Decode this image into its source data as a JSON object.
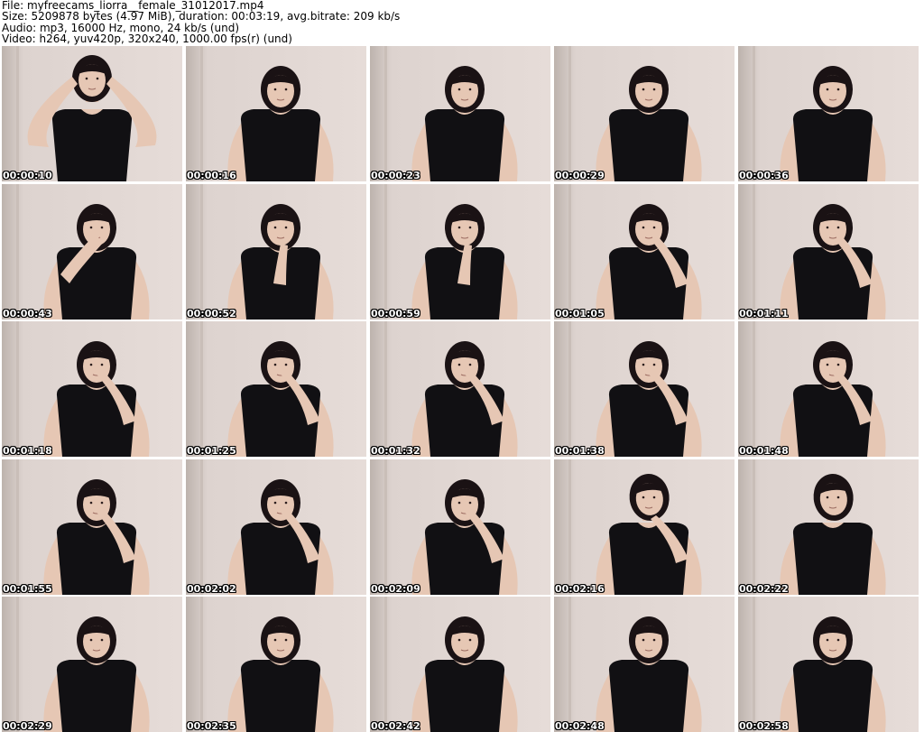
{
  "header": {
    "file": "File: myfreecams_liorra__female_31012017.mp4",
    "size": "Size: 5209878 bytes (4.97 MiB), duration: 00:03:19, avg.bitrate: 209 kb/s",
    "audio": "Audio: mp3, 16000 Hz, mono, 24 kb/s (und)",
    "video": "Video: h264, yuv420p, 320x240, 1000.00 fps(r) (und)"
  },
  "frames": [
    {
      "timestamp": "00:00:10",
      "pose": "hands-on-head"
    },
    {
      "timestamp": "00:00:16",
      "pose": "neutral"
    },
    {
      "timestamp": "00:00:23",
      "pose": "neutral"
    },
    {
      "timestamp": "00:00:29",
      "pose": "neutral"
    },
    {
      "timestamp": "00:00:36",
      "pose": "neutral"
    },
    {
      "timestamp": "00:00:43",
      "pose": "hand-over-mouth"
    },
    {
      "timestamp": "00:00:52",
      "pose": "hand-on-chin"
    },
    {
      "timestamp": "00:00:59",
      "pose": "hand-on-chin"
    },
    {
      "timestamp": "00:01:05",
      "pose": "hand-on-cheek"
    },
    {
      "timestamp": "00:01:11",
      "pose": "hand-on-cheek"
    },
    {
      "timestamp": "00:01:18",
      "pose": "finger-on-lips"
    },
    {
      "timestamp": "00:01:25",
      "pose": "finger-on-lips"
    },
    {
      "timestamp": "00:01:32",
      "pose": "finger-on-lips"
    },
    {
      "timestamp": "00:01:38",
      "pose": "finger-on-lips"
    },
    {
      "timestamp": "00:01:48",
      "pose": "finger-on-lips"
    },
    {
      "timestamp": "00:01:55",
      "pose": "finger-on-lips"
    },
    {
      "timestamp": "00:02:02",
      "pose": "finger-on-lips"
    },
    {
      "timestamp": "00:02:09",
      "pose": "finger-on-lips"
    },
    {
      "timestamp": "00:02:16",
      "pose": "head-tilted-back"
    },
    {
      "timestamp": "00:02:22",
      "pose": "head-tilted-back"
    },
    {
      "timestamp": "00:02:29",
      "pose": "neutral"
    },
    {
      "timestamp": "00:02:35",
      "pose": "neutral"
    },
    {
      "timestamp": "00:02:42",
      "pose": "neutral"
    },
    {
      "timestamp": "00:02:48",
      "pose": "neutral"
    },
    {
      "timestamp": "00:02:58",
      "pose": "neutral"
    }
  ],
  "colors": {
    "wall": "#ddd3cf",
    "wall_shadow": "#bdb3ad",
    "skin": "#e6c7b4",
    "hair": "#1a1214",
    "top": "#111013",
    "timestamp_text": "#ffffff"
  }
}
